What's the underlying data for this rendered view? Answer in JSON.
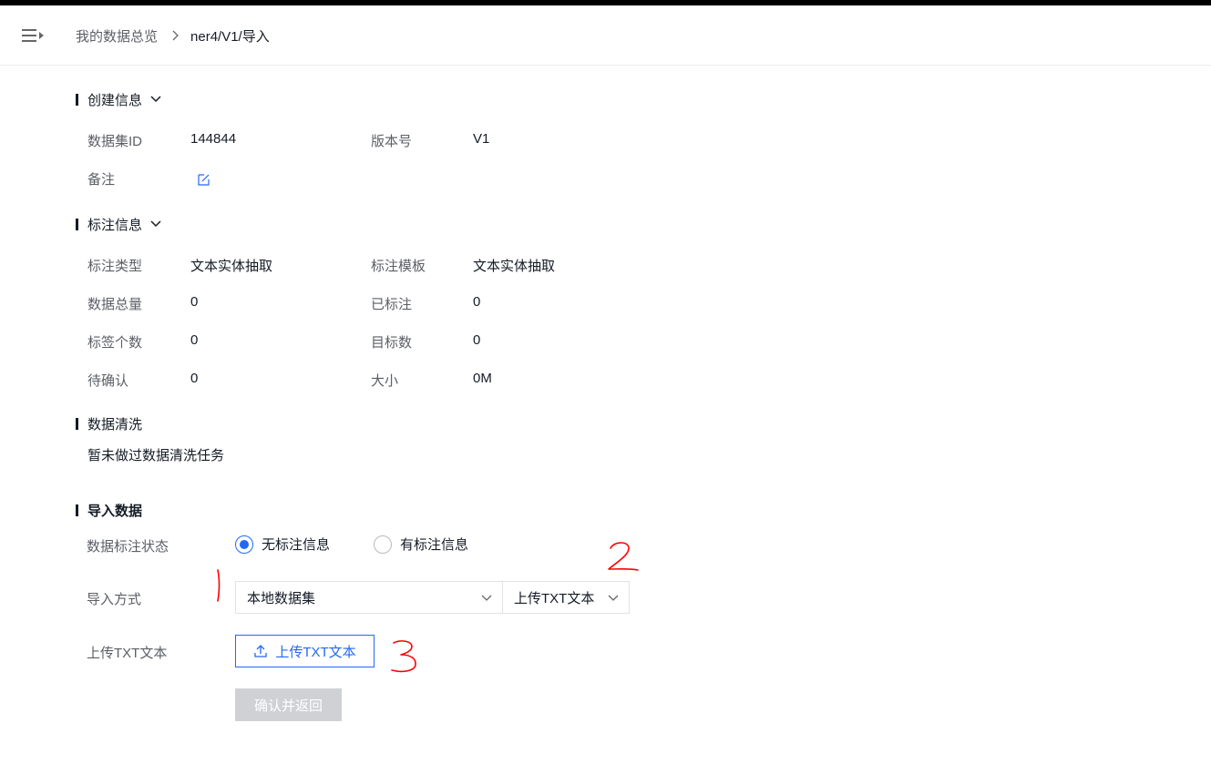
{
  "breadcrumb": {
    "home": "我的数据总览",
    "current": "ner4/V1/导入"
  },
  "creation_info": {
    "title": "创建信息",
    "dataset_id_label": "数据集ID",
    "dataset_id": "144844",
    "version_label": "版本号",
    "version": "V1",
    "remark_label": "备注"
  },
  "annotation_info": {
    "title": "标注信息",
    "type_label": "标注类型",
    "type": "文本实体抽取",
    "template_label": "标注模板",
    "template": "文本实体抽取",
    "total_label": "数据总量",
    "total": "0",
    "labeled_label": "已标注",
    "labeled": "0",
    "tag_count_label": "标签个数",
    "tag_count": "0",
    "target_count_label": "目标数",
    "target_count": "0",
    "pending_label": "待确认",
    "pending": "0",
    "size_label": "大小",
    "size": "0M"
  },
  "data_cleaning": {
    "title": "数据清洗",
    "message": "暂未做过数据清洗任务"
  },
  "import": {
    "title": "导入数据",
    "status_label": "数据标注状态",
    "status_options": [
      "无标注信息",
      "有标注信息"
    ],
    "status_selected": "无标注信息",
    "method_label": "导入方式",
    "method_source": "本地数据集",
    "method_type": "上传TXT文本",
    "upload_label": "上传TXT文本",
    "upload_button": "上传TXT文本",
    "confirm_button": "确认并返回"
  },
  "annotations": {
    "mark1": "1",
    "mark2": "2",
    "mark3": "3"
  },
  "colors": {
    "primary": "#2468f2",
    "text": "#151b26",
    "label": "#5c5f66",
    "disabled": "#cfd1d5",
    "annotation": "#ff0000"
  }
}
